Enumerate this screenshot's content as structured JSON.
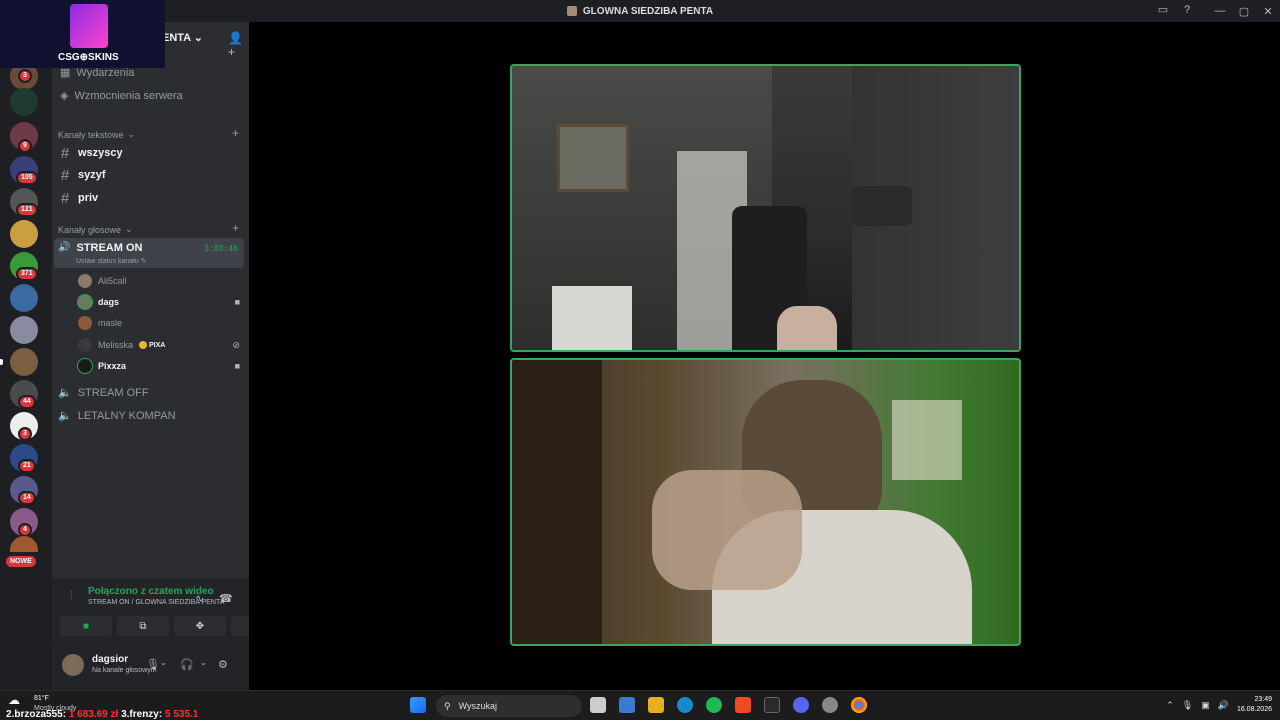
{
  "window": {
    "title": "GLOWNA SIEDZIBA PENTA"
  },
  "overlay": {
    "logo_text": "CSG⊕SKINS"
  },
  "server": {
    "name_fragment": "ENTA",
    "chevron": "⌄"
  },
  "nav": {
    "events": "Wydarzenia",
    "boosts": "Wzmocnienia serwera"
  },
  "rail_badges": [
    "3",
    "9",
    "105",
    "121",
    "371",
    "44",
    "3",
    "21",
    "14",
    "4"
  ],
  "rail_new": "NOWE",
  "categories": {
    "text": "Kanały tekstowe",
    "voice": "Kanały głosowe"
  },
  "text_channels": [
    "wszyscy",
    "syzyf",
    "priv"
  ],
  "voice_channels": {
    "active": {
      "name": "STREAM ON",
      "timer": "3:08:46",
      "status": "Ustaw status kanału"
    },
    "others": [
      "STREAM OFF",
      "LETALNY KOMPAN"
    ]
  },
  "voice_users": [
    {
      "name": "Ali5cali"
    },
    {
      "name": "dags"
    },
    {
      "name": "masle"
    },
    {
      "name": "Melisska",
      "tag": "PIXA"
    },
    {
      "name": "Pixxza"
    }
  ],
  "voice_panel": {
    "connected": "Połączono z czatem wideo",
    "location": "STREAM ON / GLOWNA SIEDZIBA PENTA"
  },
  "user_panel": {
    "username": "dagsior",
    "status": "Na kanale głosowym"
  },
  "taskbar": {
    "temp": "81°F",
    "condition": "Mostly cloudy",
    "ticker_a": "2.brzoza555:",
    "ticker_a_val": "1 683.69 zł",
    "ticker_b": "3.frenzy:",
    "ticker_b_val": "5 535.1",
    "search_placeholder": "Wyszukaj",
    "time": "23:49",
    "date": "16.08.2026"
  },
  "colors": {
    "accent_green": "#23a55a",
    "badge_red": "#da373c",
    "tile_border": "#3ba55c"
  }
}
